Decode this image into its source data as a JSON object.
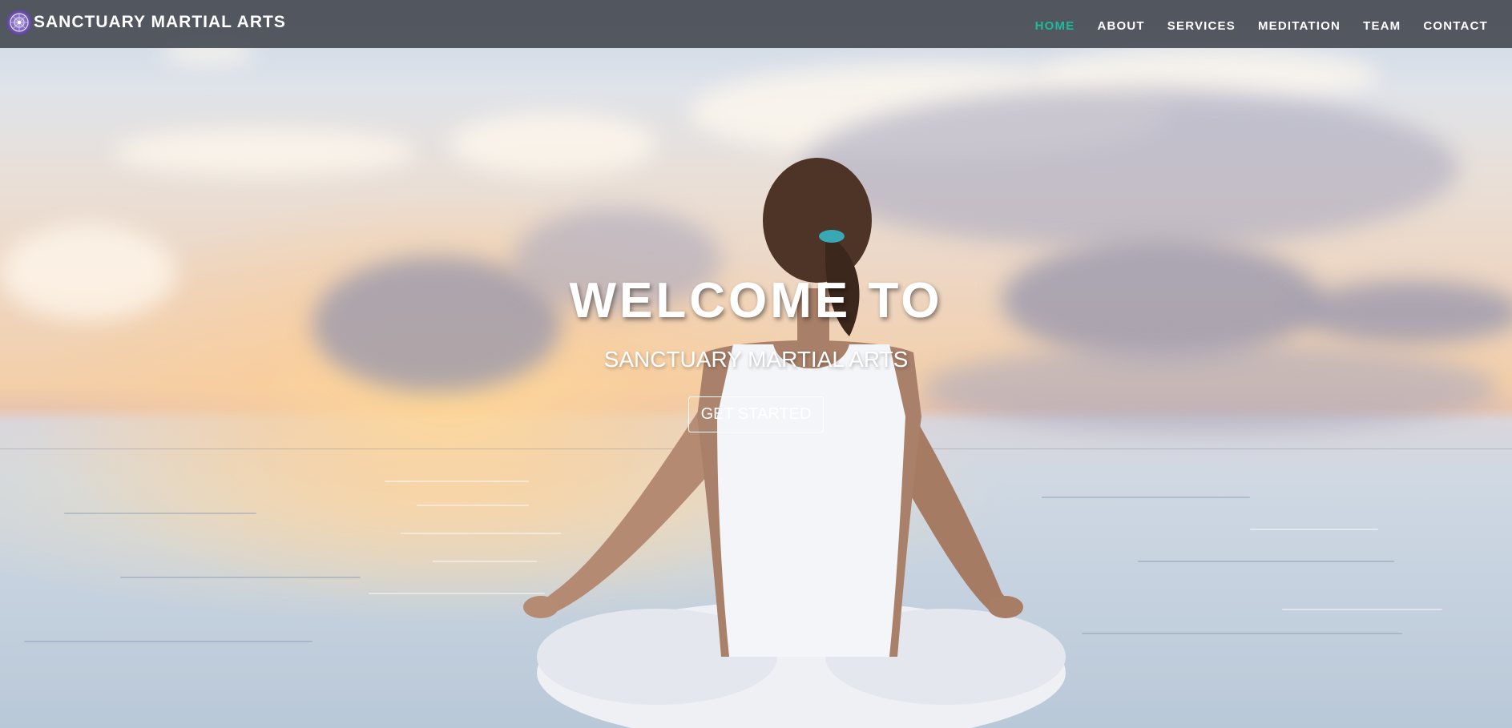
{
  "navbar": {
    "brand_text": "SANCTUARY MARTIAL ARTS",
    "brand_logo_icon": "dojo-emblem-icon",
    "items": [
      {
        "label": "HOME",
        "active": true
      },
      {
        "label": "ABOUT",
        "active": false
      },
      {
        "label": "SERVICES",
        "active": false
      },
      {
        "label": "MEDITATION",
        "active": false
      },
      {
        "label": "TEAM",
        "active": false
      },
      {
        "label": "CONTACT",
        "active": false
      }
    ],
    "active_color": "#1abc9c",
    "background_color": "#484c54"
  },
  "hero": {
    "title": "WELCOME TO",
    "subtitle": "SANCTUARY MARTIAL ARTS",
    "button_label": "GET STARTED"
  }
}
